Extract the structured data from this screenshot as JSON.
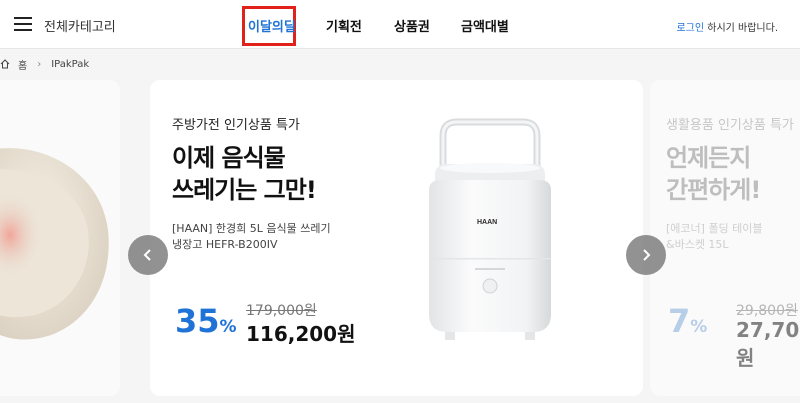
{
  "header": {
    "category_label": "전체카테고리",
    "nav": [
      {
        "label": "이달의딜"
      },
      {
        "label": "기획전"
      },
      {
        "label": "상품권"
      },
      {
        "label": "금액대별"
      }
    ],
    "login_link": "로그인",
    "login_text": " 하시기 바랍니다."
  },
  "breadcrumb": {
    "home": "홈",
    "current": "IPakPak"
  },
  "colors": {
    "accent": "#1f73d6",
    "highlight_box": "#e1221a"
  },
  "slides": {
    "main": {
      "eyebrow": "주방가전 인기상품 특가",
      "headline_line1": "이제 음식물",
      "headline_line2": "쓰레기는 그만!",
      "product_line1": "[HAAN] 한경희 5L 음식물 쓰레기",
      "product_line2": "냉장고 HEFR-B200IV",
      "brand_on_product": "HAAN",
      "discount": "35",
      "discount_unit": "%",
      "old_price": "179,000원",
      "new_price": "116,200원"
    },
    "next": {
      "eyebrow": "생활용품 인기상품 특가",
      "headline_line1": "언제든지",
      "headline_line2": "간편하게!",
      "product_line1": "[에코너] 폴딩 테이블",
      "product_line2": "&바스켓 15L",
      "discount": "7",
      "discount_unit": "%",
      "old_price": "29,800원",
      "new_price": "27,700원"
    }
  },
  "icons": {
    "menu": "hamburger-icon",
    "home": "home-icon",
    "prev": "chevron-left-icon",
    "next": "chevron-right-icon"
  }
}
